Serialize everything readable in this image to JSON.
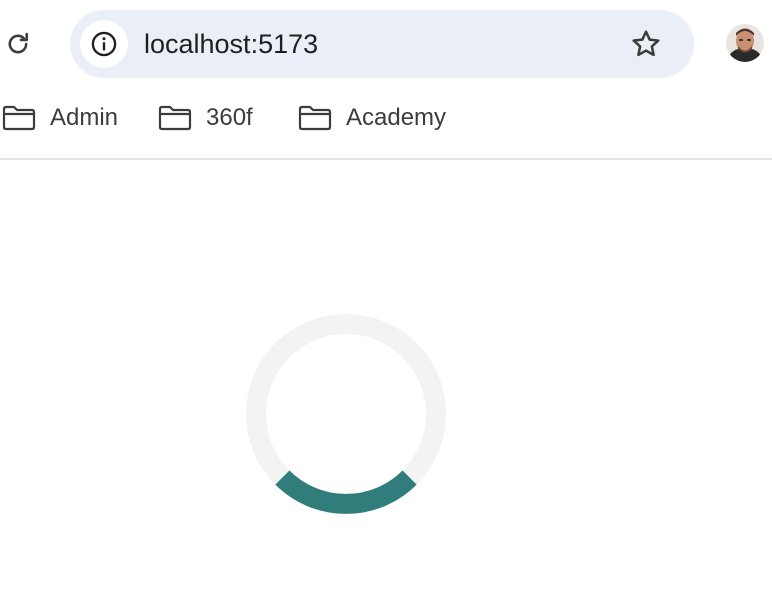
{
  "browser": {
    "address_bar": {
      "url": "localhost:5173"
    },
    "bookmarks": [
      {
        "label": "Admin"
      },
      {
        "label": "360f"
      },
      {
        "label": "Academy"
      }
    ]
  },
  "page": {
    "loading_spinner": {
      "track_color": "#f3f3f3",
      "accent_color": "#317d7b"
    }
  },
  "icons": {
    "reload": "reload-icon",
    "site_info": "info-icon",
    "bookmark_star": "star-icon",
    "folder": "folder-icon"
  }
}
